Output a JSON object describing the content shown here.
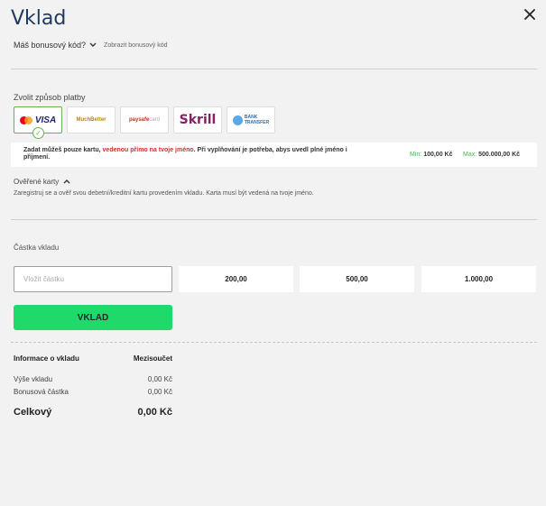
{
  "header": {
    "title": "Vklad",
    "close_icon": "close-icon"
  },
  "bonus": {
    "question": "Máš bonusový kód?",
    "toggle_icon": "chevron-down-icon",
    "link": "Zobrazit bonusový kód"
  },
  "payment": {
    "label": "Zvolit způsob platby",
    "methods": [
      {
        "name": "Mastercard / VISA",
        "logo_text": "VISA",
        "selected": true
      },
      {
        "name": "MuchBetter",
        "logo_text": "MuchBetter"
      },
      {
        "name": "paysafecard",
        "logo_text": "paysafe",
        "logo_text_2": "card"
      },
      {
        "name": "Skrill",
        "logo_text": "Skrill"
      },
      {
        "name": "Bank Transfer",
        "logo_text": "BANK",
        "logo_text_2": "TRANSFER"
      }
    ]
  },
  "notice": {
    "part1": "Zadat můžeš pouze kartu, ",
    "part2": "vedenou přímo na tvoje jméno",
    "part3": ". Při vyplňování je potřeba, abys uvedl plné jméno i příjmení.",
    "min_label": "Min:",
    "min_value": "100,00 Kč",
    "max_label": "Max:",
    "max_value": "500.000,00 Kč"
  },
  "verified": {
    "title": "Ověřené karty",
    "toggle_icon": "chevron-up-icon",
    "description": "Zaregistruj se a ověř svou debetní/kreditní kartu provedením vkladu. Karta musí být vedená na tvoje jméno."
  },
  "amount": {
    "label": "Částka vkladu",
    "placeholder": "Vložit částku",
    "presets": [
      "200,00",
      "500,00",
      "1.000,00"
    ]
  },
  "deposit_button": "VKLAD",
  "summary": {
    "header_left": "Informace o vkladu",
    "header_right": "Mezisoučet",
    "rows": [
      {
        "label": "Výše vkladu",
        "value": "0,00 Kč"
      },
      {
        "label": "Bonusová částka",
        "value": "0,00 Kč"
      }
    ],
    "total_label": "Celkový",
    "total_value": "0,00 Kč"
  },
  "colors": {
    "accent_green": "#1fd96b",
    "title_blue": "#1f3a5f",
    "warning_red": "#d32f2f",
    "minmax_green": "#4caf50"
  }
}
